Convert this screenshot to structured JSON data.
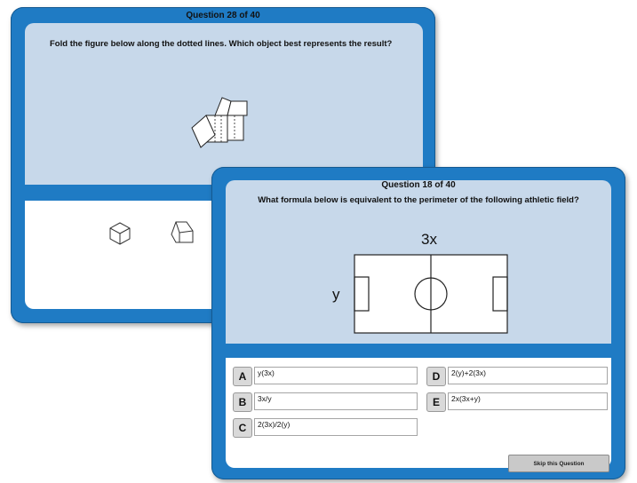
{
  "back_window": {
    "title": "Question 28 of 40",
    "question": "Fold the figure below along the dotted lines. Which object best represents the result?"
  },
  "front_window": {
    "title": "Question 18 of 40",
    "question": "What formula below is equivalent to the perimeter of the following athletic field?",
    "figure_labels": {
      "top": "3x",
      "left": "y"
    },
    "choices": [
      {
        "letter": "A",
        "text": "y(3x)"
      },
      {
        "letter": "D",
        "text": "2(y)+2(3x)"
      },
      {
        "letter": "B",
        "text": "3x/y"
      },
      {
        "letter": "E",
        "text": "2x(3x+y)"
      },
      {
        "letter": "C",
        "text": "2(3x)/2(y)"
      }
    ],
    "skip_label": "Skip this Question"
  },
  "colors": {
    "frame": "#1f7bc4",
    "pane": "#c7d8ea"
  }
}
